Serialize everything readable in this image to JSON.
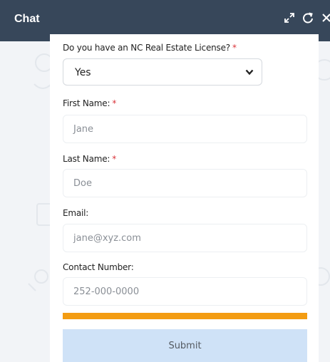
{
  "header": {
    "title": "Chat",
    "icons": [
      "expand-icon",
      "refresh-icon",
      "close-icon"
    ]
  },
  "form": {
    "license": {
      "label": "Do you have an NC Real Estate License?",
      "required_mark": "*",
      "selected": "Yes"
    },
    "first_name": {
      "label": "First Name:",
      "required_mark": "*",
      "placeholder": "Jane"
    },
    "last_name": {
      "label": "Last Name:",
      "required_mark": "*",
      "placeholder": "Doe"
    },
    "email": {
      "label": "Email:",
      "placeholder": "jane@xyz.com"
    },
    "contact": {
      "label": "Contact Number:",
      "placeholder": "252-000-0000"
    },
    "progress": 1.0,
    "submit_label": "Submit"
  },
  "colors": {
    "header_bg": "#37475a",
    "required": "#d9343a",
    "progress": "#f39c12",
    "submit_bg": "#cfe2f7"
  }
}
